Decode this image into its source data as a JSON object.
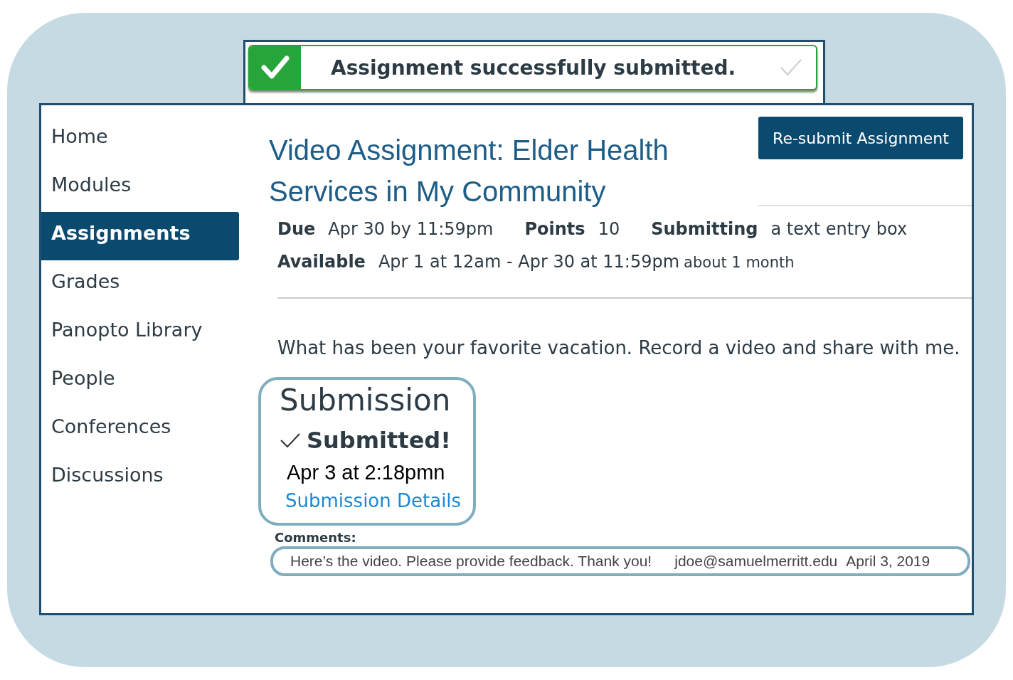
{
  "banner": {
    "message": "Assignment successfully submitted."
  },
  "nav": [
    {
      "label": "Home",
      "selected": false
    },
    {
      "label": "Modules",
      "selected": false
    },
    {
      "label": "Assignments",
      "selected": true
    },
    {
      "label": "Grades",
      "selected": false
    },
    {
      "label": "Panopto Library",
      "selected": false
    },
    {
      "label": "People",
      "selected": false
    },
    {
      "label": "Conferences",
      "selected": false
    },
    {
      "label": "Discussions",
      "selected": false
    }
  ],
  "assignment": {
    "title": "Video Assignment: Elder Health Services in My Community",
    "resubmit_button": "Re-submit Assignment",
    "due_label": "Due",
    "due": "Apr 30 by 11:59pm",
    "points_label": "Points",
    "points": "10",
    "submitting_label": "Submitting",
    "submitting": "a text entry box",
    "available_label": "Available",
    "available": "Apr 1 at 12am - Apr 30 at 11:59pm",
    "available_note": "about 1 month",
    "description": "What has been your favorite vacation. Record a video and share with me."
  },
  "submission": {
    "heading": "Submission",
    "submitted": true,
    "status": "Submitted!",
    "date": "Apr 3 at 2:18pmn",
    "details_link": "Submission Details"
  },
  "comments": {
    "label": "Comments:",
    "text": "Here’s the video. Please provide feedback. Thank you!",
    "author": "jdoe@samuelmerritt.edu",
    "date": "April 3, 2019"
  }
}
